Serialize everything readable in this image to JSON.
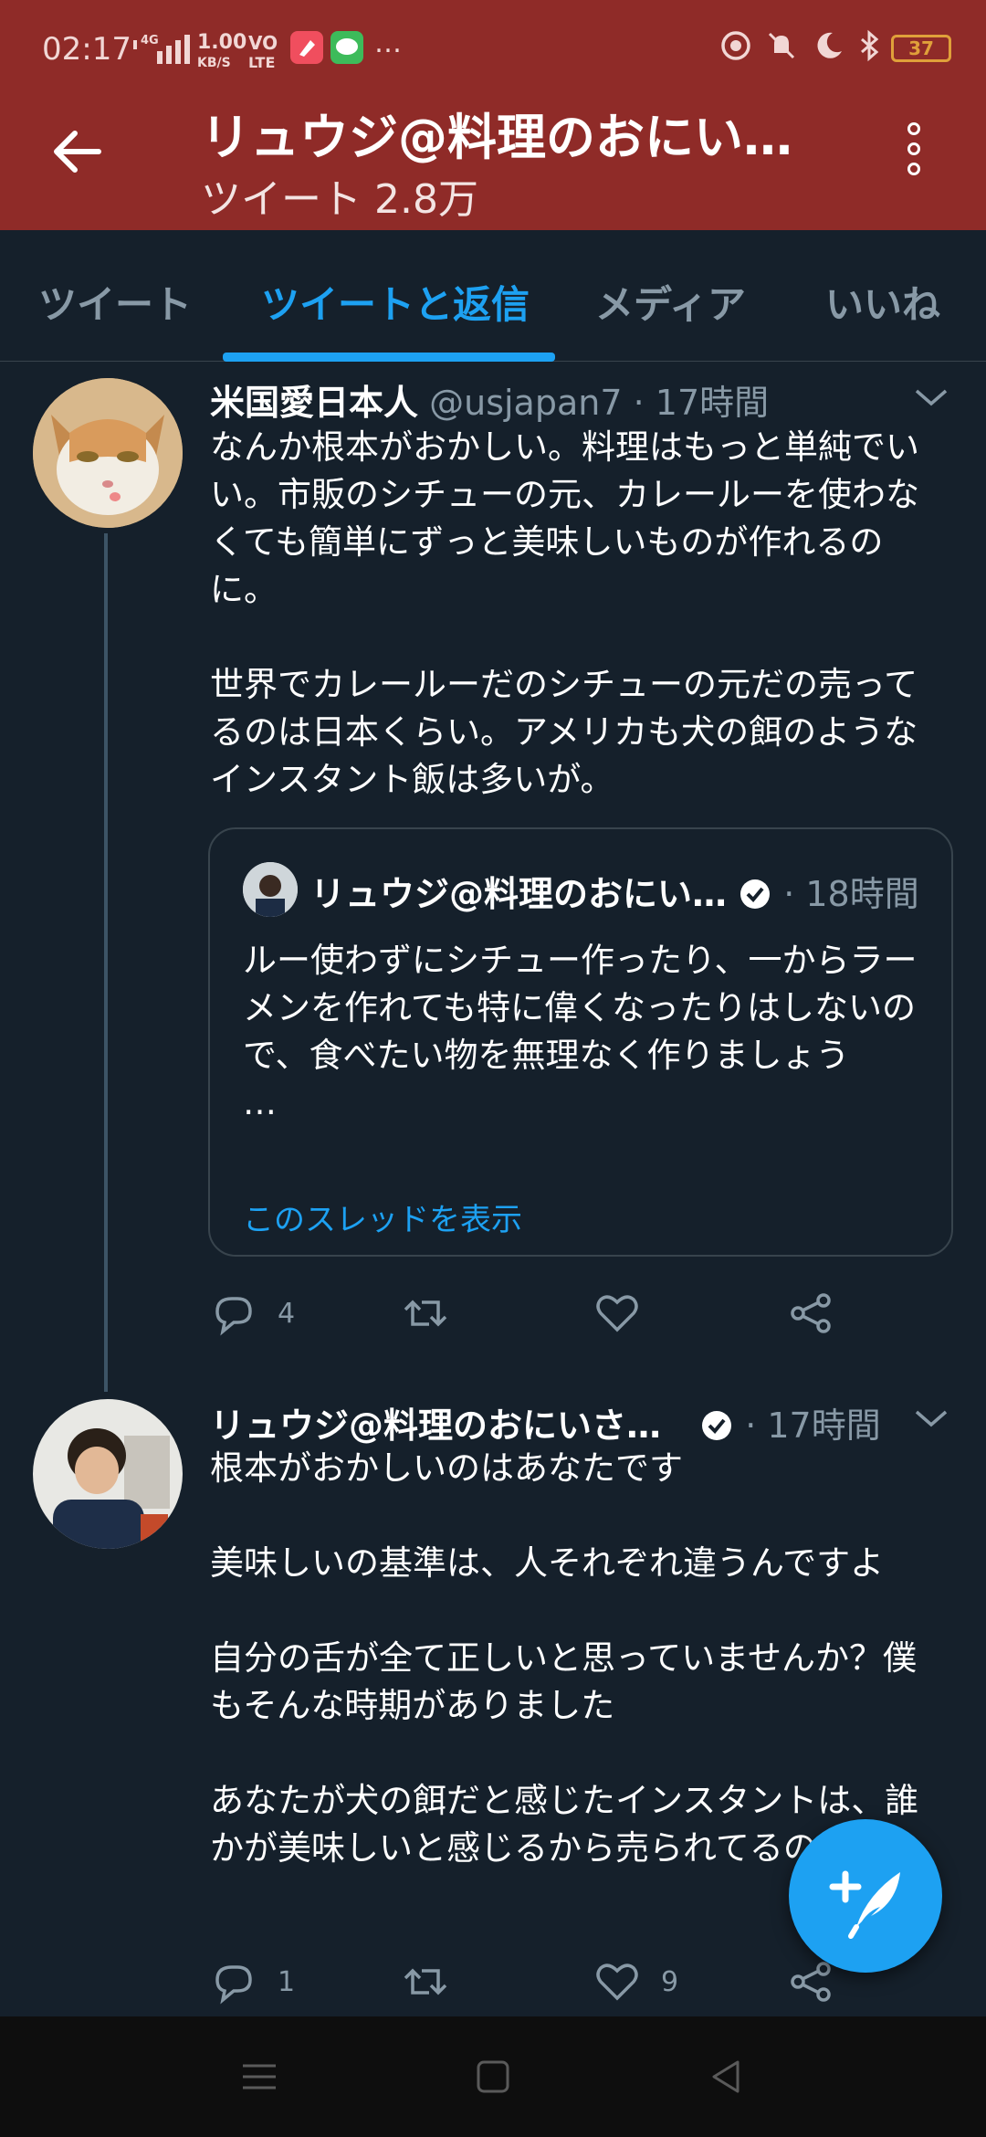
{
  "status_bar": {
    "time": "02:17",
    "network": "4G",
    "speed_value": "1.00",
    "speed_unit": "KB/S",
    "volte_top": "VO",
    "volte_bottom": "LTE",
    "more": "…",
    "battery": "37"
  },
  "header": {
    "title": "リュウジ@料理のおにい…",
    "subtitle": "ツイート 2.8万"
  },
  "tabs": [
    "ツイート",
    "ツイートと返信",
    "メディア",
    "いいね"
  ],
  "tweets": [
    {
      "name": "米国愛日本人",
      "handle": "@usjapan7",
      "time": "· 17時間",
      "body": [
        "なんか根本がおかしい。料理はもっと単純でいい。市販のシチューの元、カレールーを使わなくても簡単にずっと美味しいものが作れるのに。",
        "世界でカレールーだのシチューの元だの売ってるのは日本くらい。アメリカも犬の餌のようなインスタント飯は多いが。"
      ],
      "quote": {
        "name": "リュウジ@料理のおにい…",
        "time": "· 18時間",
        "body": "ルー使わずにシチュー作ったり、一からラーメンを作れても特に偉くなったりはしないので、食べたい物を無理なく作りましょう",
        "ellipsis": "…",
        "link": "このスレッドを表示"
      },
      "actions": {
        "reply": "4",
        "retweet": "",
        "like": ""
      }
    },
    {
      "name": "リュウジ@料理のおにいさ…",
      "time": "· 17時間",
      "body": [
        "根本がおかしいのはあなたです",
        "美味しいの基準は、人それぞれ違うんですよ",
        "自分の舌が全て正しいと思っていませんか？僕もそんな時期がありました",
        "あなたが犬の餌だと感じたインスタントは、誰かが美味しいと感じるから売られてるのですよ"
      ],
      "actions": {
        "reply": "1",
        "retweet": "",
        "like": "9"
      }
    }
  ],
  "colors": {
    "header_bg": "#8f2b28",
    "page_bg": "#15202b",
    "accent": "#1da1f2",
    "muted": "#8899a6"
  }
}
